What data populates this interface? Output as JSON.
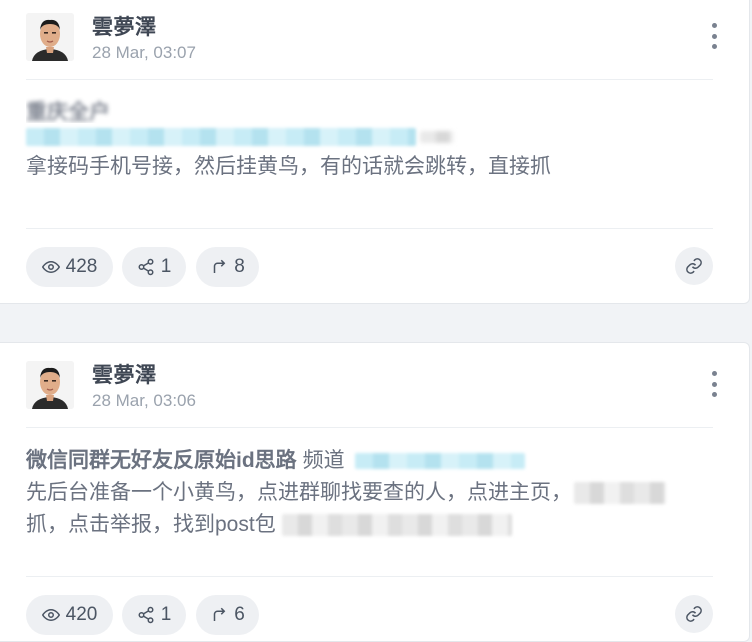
{
  "posts": [
    {
      "author": "雲夢澤",
      "time": "28 Mar, 03:07",
      "title": "重庆全户",
      "text": "拿接码手机号接，然后挂黄鸟，有的话就会跳转，直接抓",
      "views": "428",
      "shares": "1",
      "forwards": "8"
    },
    {
      "author": "雲夢澤",
      "time": "28 Mar, 03:06",
      "title": "微信同群无好友反原始id思路",
      "title_suffix": "频道",
      "line1": "先后台准备一个小黄鸟，点进群聊找要查的人，点进主页，",
      "line2": "抓，点击举报，找到post包",
      "views": "420",
      "shares": "1",
      "forwards": "6"
    }
  ],
  "icons": {
    "more": "more-vertical-icon",
    "views": "eye-icon",
    "shares": "share-nodes-icon",
    "forwards": "forward-arrow-icon",
    "link": "link-icon"
  },
  "colors": {
    "background": "#f1f3f6",
    "card": "#ffffff",
    "text": "#6b7280",
    "author": "#3f4754",
    "time": "#9aa2ad",
    "pill": "#eef0f3",
    "redacted": "#c7ecf6"
  }
}
